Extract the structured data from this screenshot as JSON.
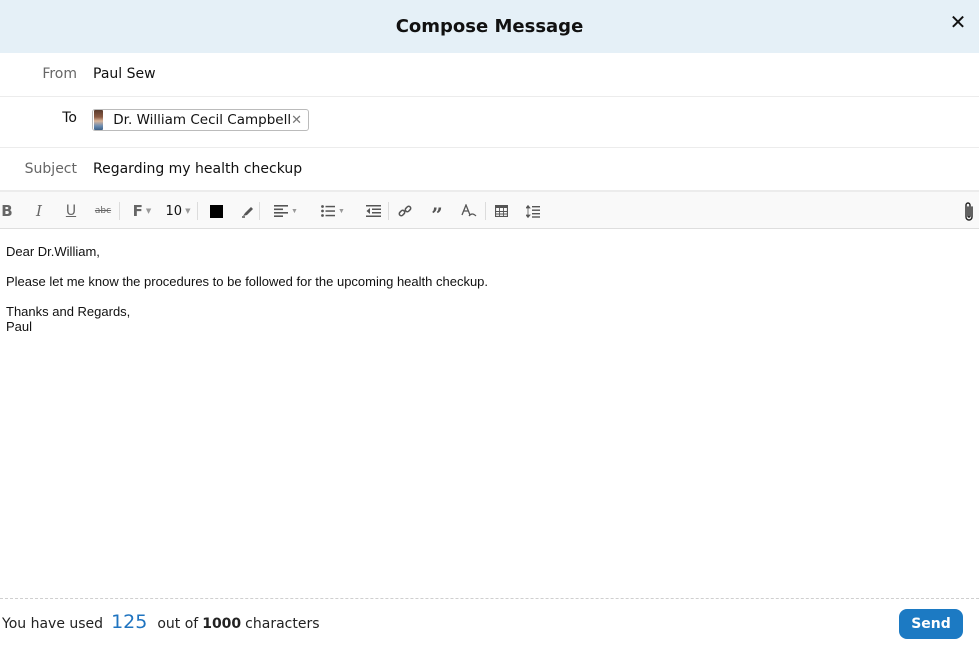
{
  "header": {
    "title": "Compose Message",
    "close_icon": "close-icon"
  },
  "fields": {
    "from_label": "From",
    "from_value": "Paul Sew",
    "to_label": "To",
    "to_recipients": [
      {
        "name": "Dr. William Cecil Campbell",
        "avatar": "recipient-avatar",
        "remove_icon": "remove-recipient-icon"
      }
    ],
    "subject_label": "Subject",
    "subject_value": "Regarding my health checkup"
  },
  "toolbar": {
    "bold": "B",
    "italic": "I",
    "underline": "U",
    "strikethrough": "abc",
    "font_family": "F",
    "font_size": "10",
    "text_color": "#000000",
    "quote": "”",
    "icons": [
      "bold-icon",
      "italic-icon",
      "underline-icon",
      "strikethrough-icon",
      "font-family-icon",
      "font-size-dropdown",
      "text-color-icon",
      "highlight-icon",
      "align-icon",
      "bullet-list-icon",
      "outdent-icon",
      "link-icon",
      "quote-icon",
      "clear-format-icon",
      "table-icon",
      "line-spacing-icon",
      "attachment-icon"
    ]
  },
  "body": {
    "greeting": "Dear Dr.William,",
    "message": "Please let me know the procedures to be followed for the upcoming health checkup.",
    "closing": "Thanks and Regards,",
    "signature": "Paul"
  },
  "footer": {
    "used_prefix": "You have used",
    "used_count": "125",
    "out_of": "out of",
    "max_count": "1000",
    "suffix": "characters",
    "send_label": "Send",
    "accent_color": "#1c7ac3"
  }
}
